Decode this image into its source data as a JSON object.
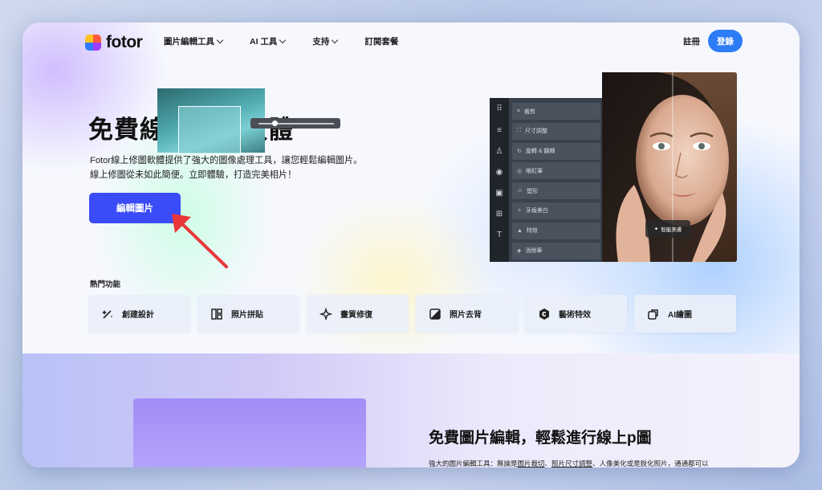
{
  "brand": {
    "name": "fotor",
    "colors": {
      "accent": "#2d7cf6",
      "cta": "#3a4cf8",
      "arrow": "#e8383b"
    }
  },
  "nav": {
    "items": [
      {
        "label": "圖片編輯工具",
        "icon": "chevron-down-icon"
      },
      {
        "label": "AI 工具",
        "icon": "chevron-down-icon"
      },
      {
        "label": "支持",
        "icon": "chevron-down-icon"
      },
      {
        "label": "訂閱套餐"
      }
    ],
    "register": "註冊",
    "login": "登錄"
  },
  "hero": {
    "title": "免費線上修圖軟體",
    "description_line1": "Fotor線上修圖軟體提供了強大的圖像處理工具，讓您輕鬆編輯圖片。",
    "description_line2": "線上修圖從未如此簡便。立即體驗，打造完美相片！",
    "cta_label": "編輯圖片"
  },
  "editor": {
    "tools": [
      "裁剪",
      "尺寸調整",
      "旋轉 & 翻轉",
      "眼紅筆",
      "塑形",
      "牙齒美白",
      "特效",
      "消除筆"
    ],
    "smart_badge": "智能美膚"
  },
  "hot_features": {
    "label": "熱門功能",
    "items": [
      {
        "label": "創建設計",
        "icon": "magic-wand-icon"
      },
      {
        "label": "照片拼貼",
        "icon": "collage-icon"
      },
      {
        "label": "畫質修復",
        "icon": "sparkle-enhance-icon"
      },
      {
        "label": "照片去背",
        "icon": "remove-bg-icon"
      },
      {
        "label": "藝術特效",
        "icon": "art-effect-icon"
      },
      {
        "label": "AI繪圖",
        "icon": "ai-draw-icon"
      }
    ]
  },
  "lower": {
    "title": "免費圖片編輯，輕鬆進行線上p圖",
    "text_prefix": "強大的圖片編輯工具：無論是",
    "link1": "圖片裁切",
    "sep": "、",
    "link2": "照片尺寸調整",
    "text_suffix": "、人像美化或是銳化照片，通通都可以"
  }
}
